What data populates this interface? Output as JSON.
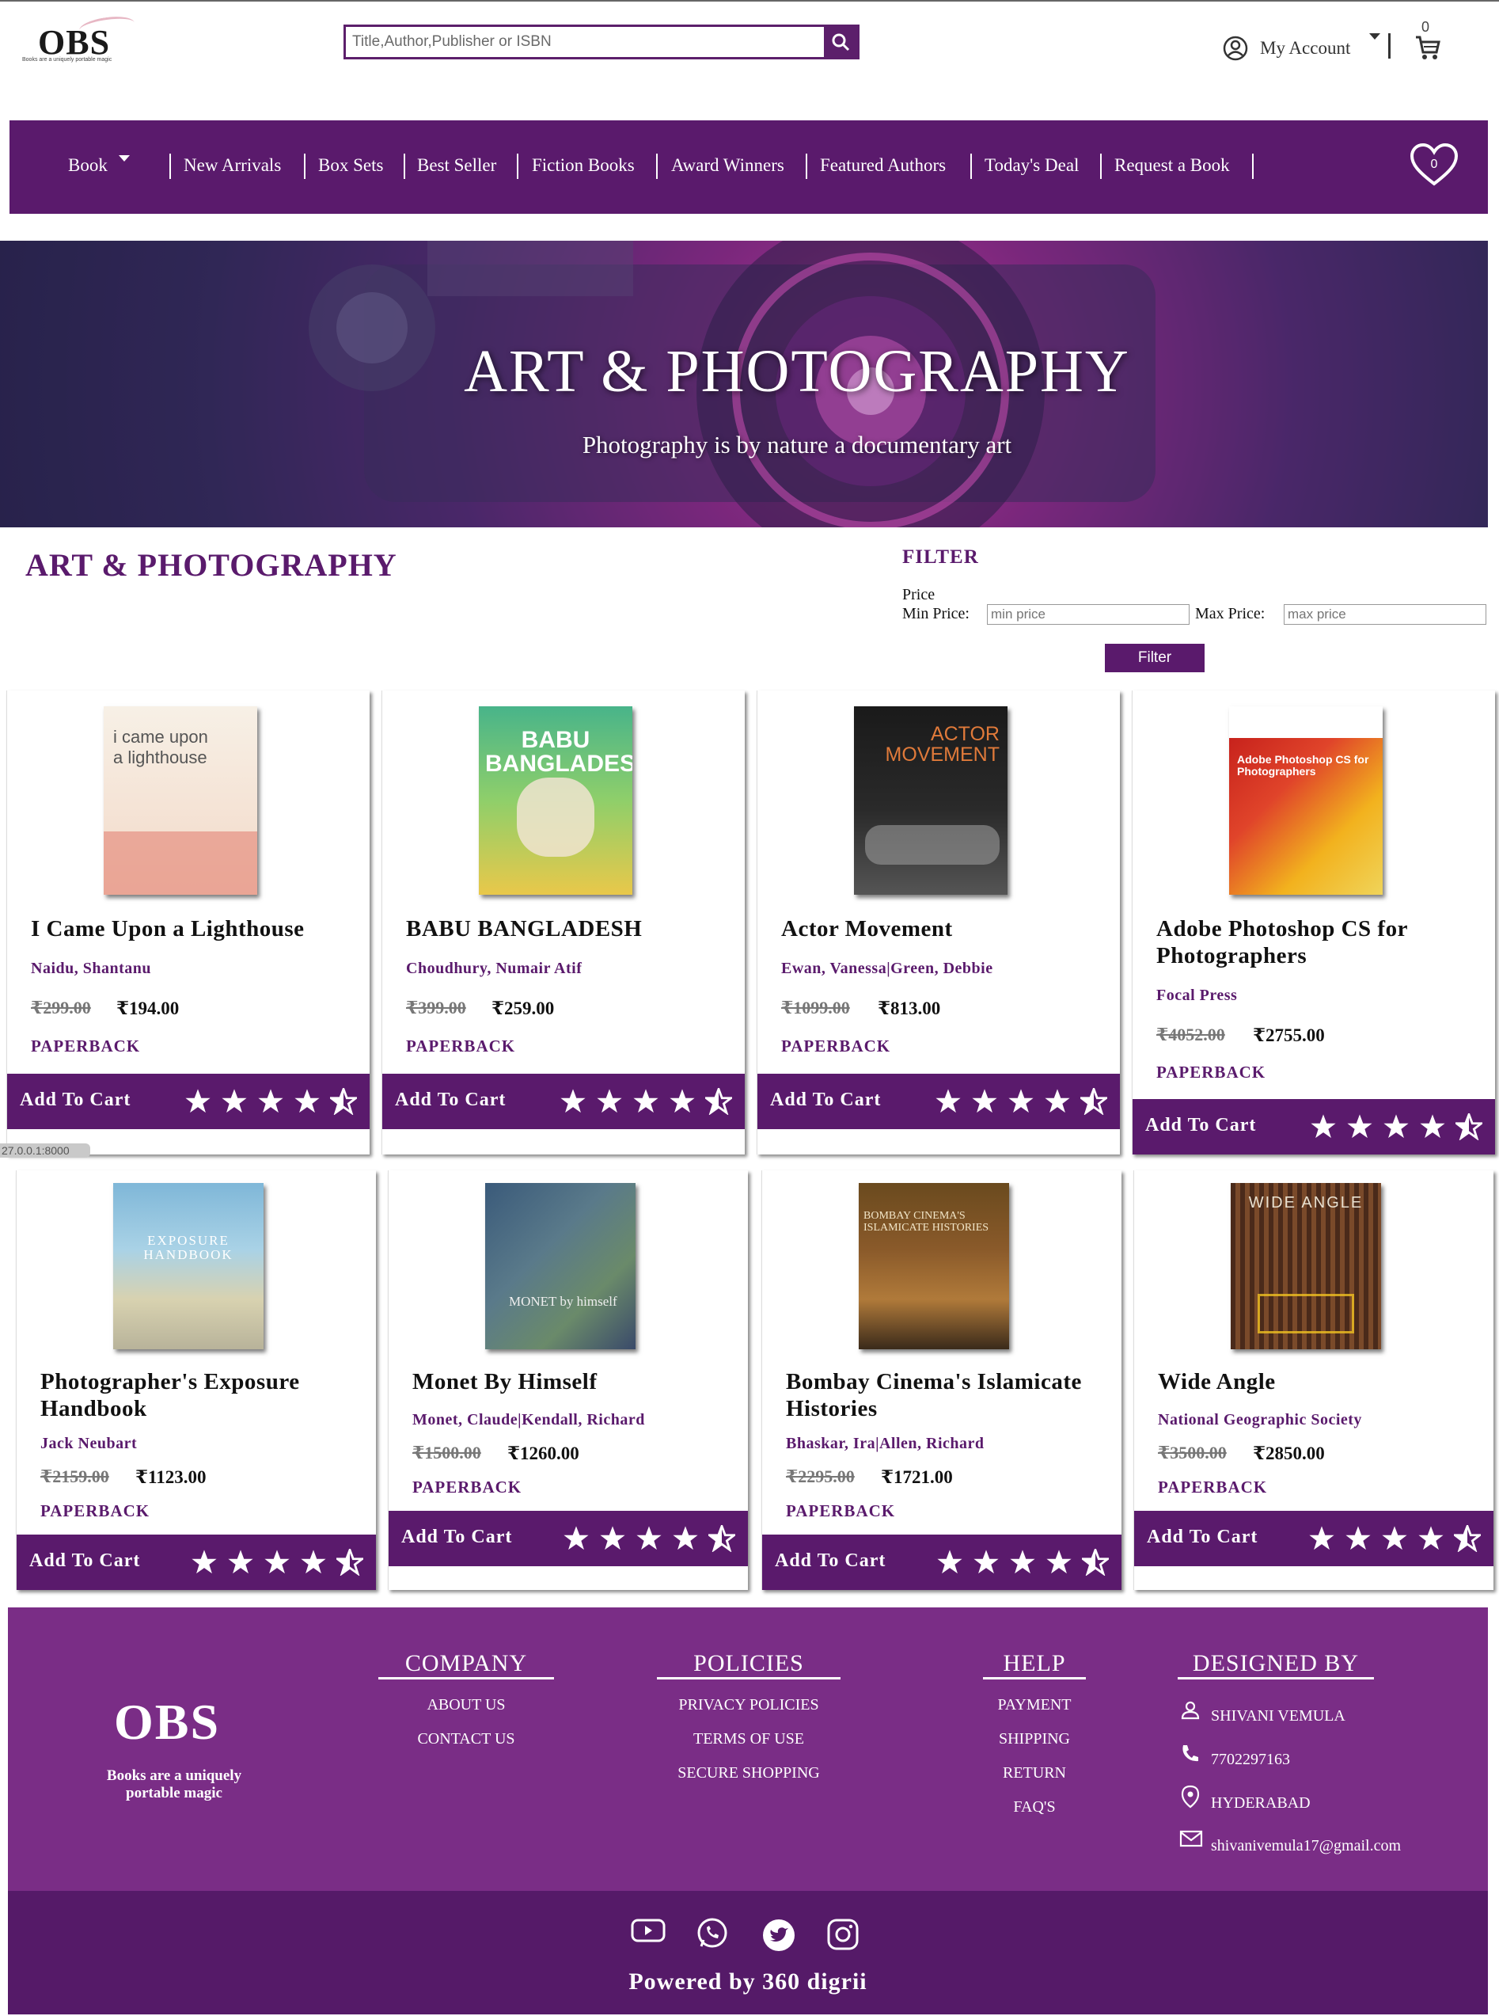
{
  "header": {
    "logo_text": "OBS",
    "logo_tagline": "Books are a uniquely portable magic",
    "search_placeholder": "Title,Author,Publisher or ISBN",
    "account_label": "My Account",
    "cart_count": "0"
  },
  "nav": {
    "items": [
      "Book",
      "New Arrivals",
      "Box Sets",
      "Best Seller",
      "Fiction Books",
      "Award Winners",
      "Featured Authors",
      "Today's Deal",
      "Request a Book"
    ],
    "wishlist_count": "0"
  },
  "hero": {
    "title": "ART & PHOTOGRAPHY",
    "subtitle": "Photography is by nature a documentary art"
  },
  "category": {
    "title": "ART & PHOTOGRAPHY"
  },
  "filter": {
    "title": "FILTER",
    "price_label": "Price",
    "min_label": "Min Price:",
    "min_placeholder": "min price",
    "max_label": "Max Price:",
    "max_placeholder": "max price",
    "button_label": "Filter"
  },
  "products": [
    {
      "title": "I Came Upon a Lighthouse",
      "author": "Naidu, Shantanu",
      "old_price": "₹299.00",
      "new_price": "₹194.00",
      "format": "PAPERBACK",
      "rating": 4.5,
      "cover_text": "i came upon a lighthouse"
    },
    {
      "title": "BABU BANGLADESH",
      "author": "Choudhury, Numair Atif",
      "old_price": "₹399.00",
      "new_price": "₹259.00",
      "format": "PAPERBACK",
      "rating": 4.5,
      "cover_text": "BABU BANGLADESH!"
    },
    {
      "title": "Actor Movement",
      "author": "Ewan, Vanessa|Green, Debbie",
      "old_price": "₹1099.00",
      "new_price": "₹813.00",
      "format": "PAPERBACK",
      "rating": 4.5,
      "cover_text": "ACTOR MOVEMENT"
    },
    {
      "title": "Adobe Photoshop CS for Photographers",
      "author": "Focal Press",
      "old_price": "₹4052.00",
      "new_price": "₹2755.00",
      "format": "PAPERBACK",
      "rating": 4.5,
      "cover_text": "Adobe Photoshop CS for Photographers"
    },
    {
      "title": "Photographer's Exposure Handbook",
      "author": "Jack Neubart",
      "old_price": "₹2159.00",
      "new_price": "₹1123.00",
      "format": "PAPERBACK",
      "rating": 4.5,
      "cover_text": "EXPOSURE HANDBOOK"
    },
    {
      "title": "Monet By Himself",
      "author": "Monet, Claude|Kendall, Richard",
      "old_price": "₹1500.00",
      "new_price": "₹1260.00",
      "format": "PAPERBACK",
      "rating": 4.5,
      "cover_text": "MONET by himself"
    },
    {
      "title": "Bombay Cinema's Islamicate Histories",
      "author": "Bhaskar, Ira|Allen, Richard",
      "old_price": "₹2295.00",
      "new_price": "₹1721.00",
      "format": "PAPERBACK",
      "rating": 4.5,
      "cover_text": "BOMBAY CINEMA'S ISLAMICATE HISTORIES"
    },
    {
      "title": "Wide Angle",
      "author": "National Geographic Society",
      "old_price": "₹3500.00",
      "new_price": "₹2850.00",
      "format": "PAPERBACK",
      "rating": 4.5,
      "cover_text": "WIDE ANGLE"
    }
  ],
  "add_to_cart_label": "Add To Cart",
  "status_url": "27.0.0.1:8000",
  "footer": {
    "logo_text": "OBS",
    "tagline": "Books are a uniquely portable magic",
    "company": {
      "heading": "COMPANY",
      "links": [
        "ABOUT US",
        "CONTACT US"
      ]
    },
    "policies": {
      "heading": "POLICIES",
      "links": [
        "PRIVACY POLICIES",
        "TERMS OF USE",
        "SECURE SHOPPING"
      ]
    },
    "help": {
      "heading": "HELP",
      "links": [
        "PAYMENT",
        "SHIPPING",
        "RETURN",
        "FAQ'S"
      ]
    },
    "designed_by": {
      "heading": "DESIGNED BY",
      "name": "SHIVANI VEMULA",
      "phone": "7702297163",
      "location": "HYDERABAD",
      "email": "shivanivemula17@gmail.com"
    },
    "social_icons": [
      "youtube-icon",
      "whatsapp-icon",
      "twitter-icon",
      "instagram-icon"
    ],
    "powered_by": "Powered by 360 digrii"
  },
  "colors": {
    "brand_purple": "#5a1a6c",
    "footer_purple": "#7a2d86",
    "footer_dark": "#551a68"
  }
}
